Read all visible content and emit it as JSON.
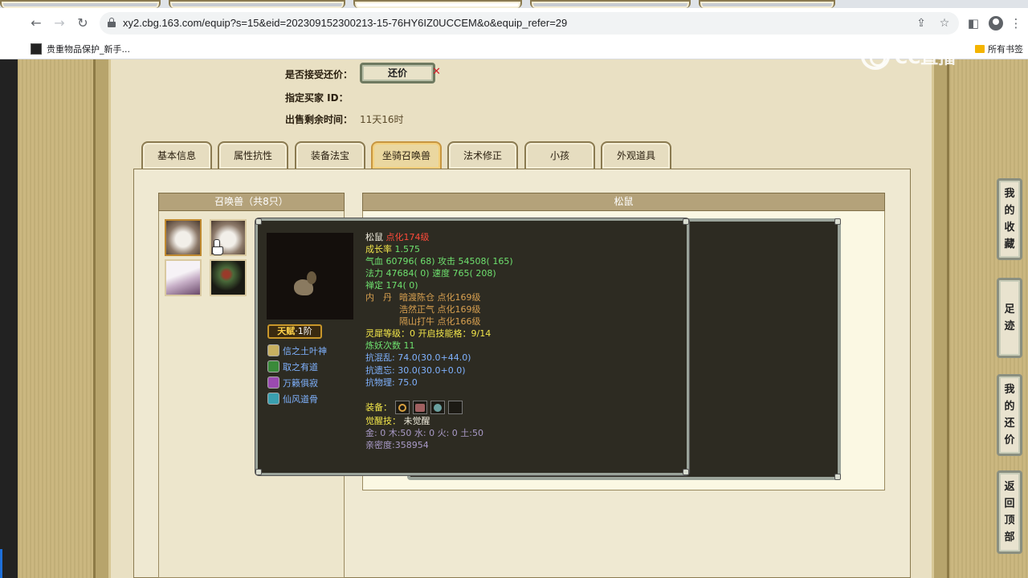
{
  "browser": {
    "url": "xy2.cbg.163.com/equip?s=15&eid=202309152300213-15-76HY6IZ0UCCEM&o&equip_refer=29",
    "bookmark_label": "贵重物品保护_新手...",
    "all_bookmarks_label": "所有书签"
  },
  "watermark": {
    "text": "CC直播"
  },
  "sale_info": {
    "accept_counter_label": "是否接受还价：",
    "counter_button": "还价",
    "buyer_id_label": "指定买家 ID：",
    "remaining_label": "出售剩余时间：",
    "remaining_value": "11天16时"
  },
  "tabs": [
    "基本信息",
    "属性抗性",
    "装备法宝",
    "坐骑召唤兽",
    "法术修正",
    "小孩",
    "外观道具"
  ],
  "pet_list": {
    "header": "召唤兽（共8只）"
  },
  "detail": {
    "header": "松鼠"
  },
  "tooltip": {
    "name": "松鼠",
    "level": "点化174级",
    "growth_label": "成长率",
    "growth_value": "1.575",
    "hp_line": "气血 60796( 68) 攻击 54508( 165)",
    "mp_line": "法力 47684( 0) 速度 765( 208)",
    "chan_line": "禅定 174( 0)",
    "neidan_label": "内　丹",
    "neidan": [
      "暗渡陈仓 点化169级",
      "浩然正气 点化169级",
      "隔山打牛 点化166级"
    ],
    "lingxi_line": "灵犀等级：0 开启技能格：9/14",
    "lianyao_line": "炼妖次数 11",
    "res_hun_line": "抗混乱: 74.0(30.0+44.0)",
    "res_yi_line": "抗遗忘: 30.0(30.0+0.0)",
    "res_wu_line": "抗物理: 75.0",
    "equip_label": "装备：",
    "awaken_label": "觉醒技：",
    "awaken_value": "未觉醒",
    "elements_line": "金: 0 木:50 水: 0 火: 0 土:50",
    "intimacy_line": "亲密度:358954",
    "talent": "天赋",
    "talent_tier": "·1阶",
    "skills": [
      "信之土叶神",
      "取之有道",
      "万籁俱寂",
      "仙风道骨"
    ]
  },
  "side_buttons": [
    {
      "chars": [
        "我",
        "的",
        "收",
        "藏"
      ]
    },
    {
      "chars": [
        "足",
        "迹"
      ]
    },
    {
      "chars": [
        "我",
        "的",
        "还",
        "价"
      ]
    },
    {
      "chars": [
        "返",
        "回",
        "顶",
        "部"
      ]
    }
  ],
  "colors": {
    "page_bg": "#c9b57c",
    "content_bg": "#e9e0c3",
    "tooltip_bg": "#2d2b22",
    "title_red": "#ff4a3a",
    "stat_green": "#6ee06e",
    "label_yellow": "#f2e64a",
    "skill_blue": "#7fb2ff"
  }
}
